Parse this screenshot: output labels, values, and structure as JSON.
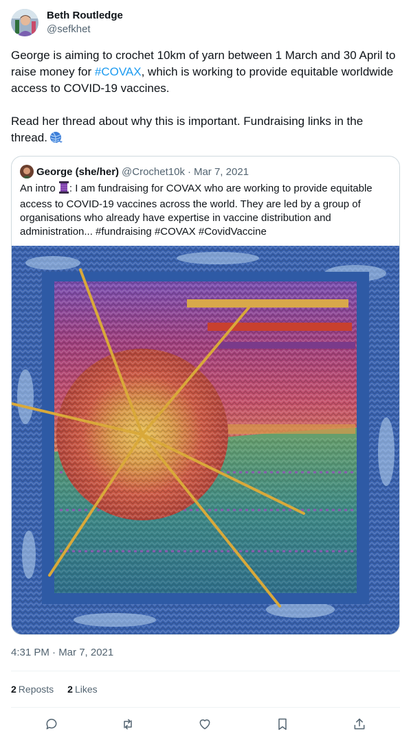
{
  "author": {
    "name": "Beth Routledge",
    "handle": "@sefkhet"
  },
  "tweet": {
    "line1_before": "George is aiming to crochet 10km of yarn between 1 March and 30 April to raise money for ",
    "hashtag": "#COVAX",
    "line1_after": ", which is working to provide equitable worldwide access to COVID-19 vaccines.",
    "line2": "Read her thread about why this is important. Fundraising links in the thread.",
    "emoji": "yarn-ball-icon"
  },
  "quoted_tweet": {
    "name": "George (she/her)",
    "handle": "@Crochet10k",
    "separator": "·",
    "date": "Mar 7, 2021",
    "text_before_emoji": "An intro ",
    "text_after_emoji": ": I am fundraising for COVAX who are working to provide equitable access to COVID-19 vaccines across the world. They are led by a group of organisations who already have expertise in vaccine distribution and administration... #fundraising #COVAX #CovidVaccine",
    "emoji": "thread-spool-icon",
    "image": "crochet-square-photo"
  },
  "timestamp": "4:31 PM · Mar 7, 2021",
  "stats": {
    "reposts_count": "2",
    "reposts_label": "Reposts",
    "likes_count": "2",
    "likes_label": "Likes"
  },
  "actions": [
    "reply-icon",
    "repost-icon",
    "like-icon",
    "bookmark-icon",
    "share-icon"
  ],
  "colors": {
    "text": "#0f1419",
    "secondary": "#536471",
    "link": "#1d9bf0",
    "border": "#cfd9de"
  }
}
